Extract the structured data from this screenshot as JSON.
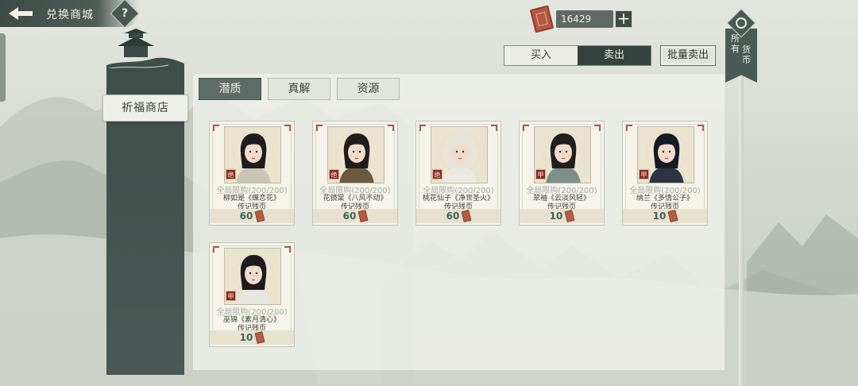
{
  "header": {
    "title": "兑换商城",
    "back_icon": "back-arrow-icon",
    "help_label": "?"
  },
  "currency": {
    "amount": "16429",
    "icon": "ticket-icon",
    "add_label": "+"
  },
  "all_currency": {
    "label_col1": "所有",
    "label_col2": "货币"
  },
  "trade_tabs": {
    "buy": "买入",
    "sell": "卖出",
    "active": "sell"
  },
  "bulk_sell_label": "批量卖出",
  "store": {
    "name": "祈福商店"
  },
  "categories": [
    {
      "label": "潜质",
      "active": true
    },
    {
      "label": "真解",
      "active": false
    },
    {
      "label": "资源",
      "active": false
    }
  ],
  "items": [
    {
      "limit": "全局限购(200/200)",
      "name": "柳如是《蝶恋花》",
      "sub": "传记残页",
      "price": "60",
      "rarity": "绝",
      "hair": "#1f1c1d",
      "robe": "#c9c4b4"
    },
    {
      "limit": "全局限购(200/200)",
      "name": "花镜棠《八风不动》",
      "sub": "传记残页",
      "price": "60",
      "rarity": "绝",
      "hair": "#221d1a",
      "robe": "#6b5a40"
    },
    {
      "limit": "全局限购(200/200)",
      "name": "桃花仙子《净世圣火》",
      "sub": "传记残页",
      "price": "60",
      "rarity": "绝",
      "hair": "#e7e3da",
      "robe": "#ece9e2"
    },
    {
      "limit": "全局限购(200/200)",
      "name": "翠袖《云淡风轻》",
      "sub": "传记残页",
      "price": "10",
      "rarity": "甲",
      "hair": "#241f1e",
      "robe": "#7d8f8a"
    },
    {
      "limit": "全局限购(200/200)",
      "name": "纳兰《多情公子》",
      "sub": "传记残页",
      "price": "10",
      "rarity": "甲",
      "hair": "#161a24",
      "robe": "#2d3444"
    },
    {
      "limit": "全局限购(200/200)",
      "name": "巫锦《素月清心》",
      "sub": "传记残页",
      "price": "10",
      "rarity": "甲",
      "hair": "#1d1b1c",
      "robe": "#e7e5df"
    }
  ]
}
